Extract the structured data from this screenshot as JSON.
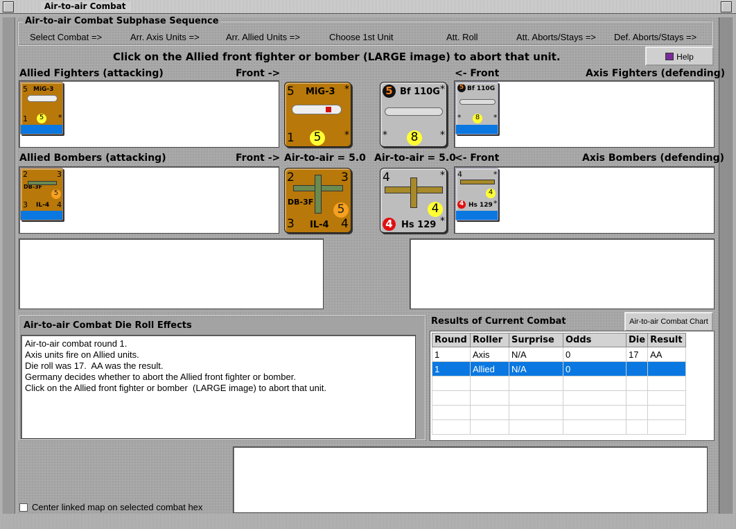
{
  "window": {
    "title": "Air-to-air Combat"
  },
  "subphase": {
    "title": "Air-to-air Combat Subphase Sequence",
    "steps": [
      "Select Combat =>",
      "Arr. Axis Units =>",
      "Arr. Allied Units =>",
      "Choose 1st Unit",
      "Att. Roll",
      "Att. Aborts/Stays =>",
      "Def. Aborts/Stays =>"
    ]
  },
  "instruction": "Click on the Allied front fighter or bomber  (LARGE image) to abort that unit.",
  "help_label": "Help",
  "labels": {
    "allied_fighters": "Allied Fighters (attacking)",
    "front_right": "Front ->",
    "front_left": "<- Front",
    "axis_fighters": "Axis Fighters (defending)",
    "allied_bombers": "Allied Bombers (attacking)",
    "air_to_air_allied": "Air-to-air = 5.0",
    "air_to_air_axis": "Air-to-air = 5.0",
    "axis_bombers": "Axis Bombers (defending)"
  },
  "counters": {
    "mig3": {
      "name": "MiG-3",
      "top_left": "5",
      "bottom_left": "1",
      "value": "5",
      "star_top": "*",
      "star_bottom": "*"
    },
    "bf110": {
      "name": "Bf 110G",
      "top_left": "5",
      "value": "8",
      "star_top": "*",
      "star_bl": "*",
      "star_br": "*"
    },
    "db3f": {
      "name_top": "DB-3F",
      "name_bottom": "IL-4",
      "tl": "2",
      "tr": "3",
      "bl": "3",
      "br": "4",
      "value": "5"
    },
    "hs129": {
      "name": "Hs 129",
      "tl": "4",
      "value": "4",
      "red": "4",
      "star_top": "*",
      "star_bottom": "*"
    }
  },
  "die_roll": {
    "title": "Air-to-air Combat Die Roll Effects",
    "lines": [
      "Air-to-air combat round 1.",
      "Axis units fire on Allied units.",
      "Die roll was 17.  AA was the result.",
      "Germany decides whether to abort the Allied front fighter or bomber.",
      "Click on the Allied front fighter or bomber  (LARGE image) to abort that unit."
    ]
  },
  "results": {
    "title": "Results of Current Combat",
    "chart_button": "Air-to-air Combat Chart",
    "columns": [
      "Round",
      "Roller",
      "Surprise",
      "Odds",
      "Die",
      "Result"
    ],
    "rows": [
      [
        "1",
        "Axis",
        "N/A",
        "0",
        "17",
        "AA"
      ],
      [
        "1",
        "Allied",
        "N/A",
        "0",
        "",
        ""
      ]
    ]
  },
  "center_map_label": "Center linked map on selected combat hex",
  "colors": {
    "highlight": "#0a78e0",
    "counter_allied": "#b8780a",
    "counter_axis": "#bdbdbd"
  }
}
